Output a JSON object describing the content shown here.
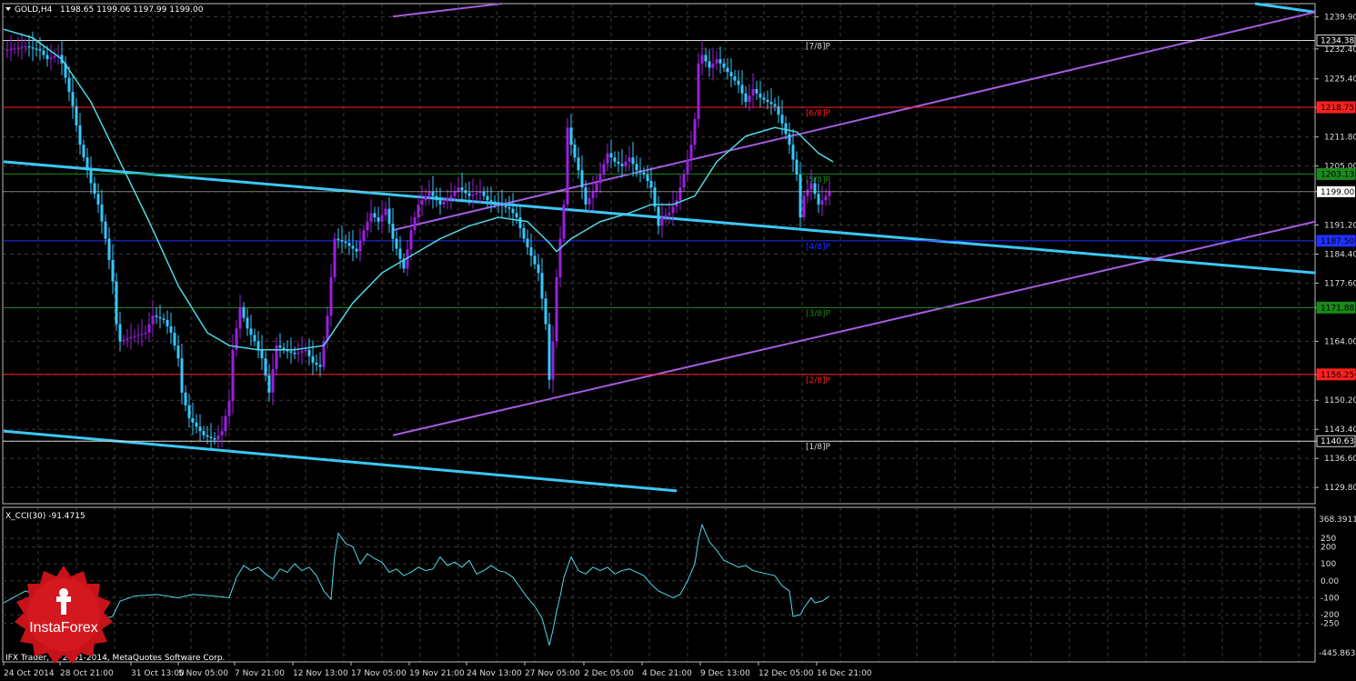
{
  "header": {
    "symbol": "GOLD,H4",
    "ohlc": "1198.65 1199.06 1197.99 1199.00"
  },
  "indicator": {
    "label": "X_CCI(30) -91.4715",
    "max_label": "368.3911",
    "min_label": "-445.8639",
    "levels": [
      "250",
      "200",
      "100",
      "0.00",
      "-100",
      "-200",
      "-250"
    ]
  },
  "footer": {
    "copyright": "IFX Trader, © 2001-2014, MetaQuotes Software Corp."
  },
  "logo": {
    "text": "InstaForex"
  },
  "colors": {
    "background": "#000000",
    "grid": "#3a3a3a",
    "bull": "#9b1fe0",
    "bear": "#35c8ff",
    "ma": "#4fd8e6",
    "channel_cyan": "#3cc7f5",
    "channel_violet": "#a65be0",
    "level_red": "#ff2020",
    "level_blue": "#2030ff",
    "level_green": "#1a8a1a",
    "level_white": "#d8d8d8"
  },
  "chart_data": {
    "type": "candlestick",
    "symbol": "GOLD",
    "timeframe": "H4",
    "price_axis": {
      "ylim": [
        1126.0,
        1243.0
      ],
      "ticks": [
        "1239.90",
        "1232.40",
        "1225.40",
        "1218.75",
        "1211.80",
        "1205.00",
        "1199.00",
        "1191.20",
        "1184.40",
        "1177.60",
        "1171.88",
        "1164.00",
        "1156.20",
        "1150.20",
        "1143.40",
        "1140.63",
        "1136.60",
        "1129.80"
      ]
    },
    "time_labels": [
      "24 Oct 2014",
      "28 Oct 21:00",
      "31 Oct 13:00",
      "5 Nov 05:00",
      "7 Nov 21:00",
      "12 Nov 13:00",
      "17 Nov 05:00",
      "19 Nov 21:00",
      "24 Nov 13:00",
      "27 Nov 05:00",
      "2 Dec 05:00",
      "4 Dec 21:00",
      "9 Dec 13:00",
      "12 Dec 05:00",
      "16 Dec 21:00"
    ],
    "current_price": "1199.00",
    "murrey_levels": [
      {
        "price": 1234.38,
        "label": "[7/8]P",
        "price_label": "1234.38",
        "color": "#d8d8d8"
      },
      {
        "price": 1218.75,
        "label": "[6/8]P",
        "price_label": "1218.75",
        "color": "#ff2020"
      },
      {
        "price": 1203.13,
        "label": "[5/8]P",
        "price_label": "1203.13",
        "color": "#1a8a1a"
      },
      {
        "price": 1187.5,
        "label": "[4/8]P",
        "price_label": "1187.50",
        "color": "#2030ff"
      },
      {
        "price": 1171.88,
        "label": "[3/8]P",
        "price_label": "1171.88",
        "color": "#1a8a1a"
      },
      {
        "price": 1156.25,
        "label": "[2/8]P",
        "price_label": "1156.25",
        "color": "#ff2020"
      },
      {
        "price": 1140.63,
        "label": "[1/8]P",
        "price_label": "1140.63",
        "color": "#d8d8d8"
      }
    ],
    "price_path": [
      [
        0,
        1232
      ],
      [
        6,
        1233
      ],
      [
        10,
        1232
      ],
      [
        12,
        1230
      ],
      [
        15,
        1231
      ],
      [
        16,
        1229
      ],
      [
        19,
        1219
      ],
      [
        21,
        1210
      ],
      [
        24,
        1201
      ],
      [
        26,
        1196
      ],
      [
        28,
        1188
      ],
      [
        30,
        1178
      ],
      [
        31,
        1168
      ],
      [
        32,
        1164
      ],
      [
        35,
        1165
      ],
      [
        39,
        1166
      ],
      [
        41,
        1170
      ],
      [
        44,
        1169
      ],
      [
        46,
        1166
      ],
      [
        48,
        1160
      ],
      [
        49,
        1152
      ],
      [
        51,
        1146
      ],
      [
        53,
        1144
      ],
      [
        55,
        1142
      ],
      [
        58,
        1141
      ],
      [
        60,
        1143
      ],
      [
        62,
        1150
      ],
      [
        63,
        1162
      ],
      [
        65,
        1172
      ],
      [
        67,
        1167
      ],
      [
        69,
        1164
      ],
      [
        71,
        1160
      ],
      [
        73,
        1152
      ],
      [
        75,
        1163
      ],
      [
        77,
        1162
      ],
      [
        80,
        1161
      ],
      [
        83,
        1162
      ],
      [
        85,
        1159
      ],
      [
        87,
        1158
      ],
      [
        89,
        1170
      ],
      [
        91,
        1188
      ],
      [
        94,
        1187
      ],
      [
        97,
        1185
      ],
      [
        99,
        1190
      ],
      [
        101,
        1194
      ],
      [
        103,
        1192
      ],
      [
        105,
        1195
      ],
      [
        107,
        1188
      ],
      [
        110,
        1181
      ],
      [
        112,
        1190
      ],
      [
        114,
        1196
      ],
      [
        117,
        1199
      ],
      [
        120,
        1196
      ],
      [
        123,
        1198
      ],
      [
        125,
        1200
      ],
      [
        128,
        1198
      ],
      [
        131,
        1199
      ],
      [
        133,
        1197
      ],
      [
        136,
        1196
      ],
      [
        139,
        1195
      ],
      [
        141,
        1193
      ],
      [
        143,
        1188
      ],
      [
        145,
        1184
      ],
      [
        147,
        1180
      ],
      [
        149,
        1168
      ],
      [
        150,
        1155
      ],
      [
        151,
        1164
      ],
      [
        152,
        1179
      ],
      [
        153,
        1188
      ],
      [
        154,
        1196
      ],
      [
        155,
        1214
      ],
      [
        156,
        1210
      ],
      [
        158,
        1204
      ],
      [
        160,
        1196
      ],
      [
        162,
        1199
      ],
      [
        164,
        1203
      ],
      [
        166,
        1208
      ],
      [
        168,
        1206
      ],
      [
        170,
        1205
      ],
      [
        172,
        1207
      ],
      [
        174,
        1204
      ],
      [
        176,
        1203
      ],
      [
        178,
        1200
      ],
      [
        180,
        1191
      ],
      [
        181,
        1193
      ],
      [
        183,
        1194
      ],
      [
        185,
        1197
      ],
      [
        187,
        1203
      ],
      [
        189,
        1210
      ],
      [
        190,
        1216
      ],
      [
        191,
        1229
      ],
      [
        192,
        1231
      ],
      [
        194,
        1228
      ],
      [
        196,
        1230
      ],
      [
        198,
        1228
      ],
      [
        200,
        1226
      ],
      [
        202,
        1224
      ],
      [
        204,
        1220
      ],
      [
        206,
        1223
      ],
      [
        208,
        1221
      ],
      [
        210,
        1220
      ],
      [
        212,
        1219
      ],
      [
        214,
        1215
      ],
      [
        216,
        1210
      ],
      [
        218,
        1203
      ],
      [
        219,
        1193
      ],
      [
        220,
        1198
      ],
      [
        222,
        1201
      ],
      [
        224,
        1196
      ],
      [
        225,
        1197
      ],
      [
        227,
        1199
      ]
    ],
    "moving_average": [
      [
        0,
        1237
      ],
      [
        8,
        1235
      ],
      [
        16,
        1230
      ],
      [
        24,
        1220
      ],
      [
        32,
        1206
      ],
      [
        40,
        1192
      ],
      [
        48,
        1177
      ],
      [
        56,
        1166
      ],
      [
        62,
        1163
      ],
      [
        70,
        1162
      ],
      [
        80,
        1162
      ],
      [
        88,
        1163
      ],
      [
        96,
        1173
      ],
      [
        104,
        1180
      ],
      [
        112,
        1184
      ],
      [
        120,
        1188
      ],
      [
        128,
        1191
      ],
      [
        136,
        1193
      ],
      [
        144,
        1192
      ],
      [
        150,
        1187
      ],
      [
        152,
        1185
      ],
      [
        156,
        1188
      ],
      [
        164,
        1192
      ],
      [
        172,
        1194
      ],
      [
        178,
        1196
      ],
      [
        184,
        1196
      ],
      [
        190,
        1198
      ],
      [
        196,
        1206
      ],
      [
        204,
        1212
      ],
      [
        212,
        1214
      ],
      [
        218,
        1213
      ],
      [
        224,
        1208
      ],
      [
        228,
        1206
      ]
    ],
    "trend_lines": [
      {
        "color": "cyan",
        "points": [
          [
            0,
            1206
          ],
          [
            370,
            1180
          ]
        ]
      },
      {
        "color": "cyan",
        "points": [
          [
            0,
            1143
          ],
          [
            185,
            1129
          ]
        ]
      },
      {
        "color": "cyan",
        "points": [
          [
            344,
            1243
          ],
          [
            370,
            1241
          ]
        ]
      },
      {
        "color": "violet",
        "points": [
          [
            107,
            1190
          ],
          [
            370,
            1241
          ]
        ]
      },
      {
        "color": "violet",
        "points": [
          [
            107,
            1142
          ],
          [
            370,
            1192
          ]
        ]
      },
      {
        "color": "violet",
        "points": [
          [
            107,
            1240
          ],
          [
            137,
            1243
          ]
        ]
      }
    ],
    "cci": {
      "ylim": [
        -445.8639,
        368.3911
      ],
      "levels": [
        250,
        200,
        100,
        0,
        -100,
        -200,
        -250
      ],
      "path": [
        [
          0,
          -130
        ],
        [
          6,
          -60
        ],
        [
          10,
          -90
        ],
        [
          14,
          -70
        ],
        [
          18,
          -110
        ],
        [
          22,
          -180
        ],
        [
          26,
          -230
        ],
        [
          30,
          -210
        ],
        [
          32,
          -120
        ],
        [
          36,
          -90
        ],
        [
          42,
          -80
        ],
        [
          48,
          -100
        ],
        [
          52,
          -80
        ],
        [
          58,
          -90
        ],
        [
          62,
          -100
        ],
        [
          64,
          20
        ],
        [
          66,
          90
        ],
        [
          68,
          60
        ],
        [
          70,
          80
        ],
        [
          72,
          40
        ],
        [
          74,
          10
        ],
        [
          76,
          70
        ],
        [
          78,
          50
        ],
        [
          80,
          100
        ],
        [
          82,
          60
        ],
        [
          84,
          80
        ],
        [
          86,
          30
        ],
        [
          88,
          -60
        ],
        [
          90,
          -110
        ],
        [
          91,
          150
        ],
        [
          92,
          280
        ],
        [
          94,
          220
        ],
        [
          96,
          200
        ],
        [
          98,
          100
        ],
        [
          100,
          160
        ],
        [
          102,
          130
        ],
        [
          104,
          110
        ],
        [
          106,
          50
        ],
        [
          108,
          70
        ],
        [
          110,
          30
        ],
        [
          112,
          50
        ],
        [
          114,
          80
        ],
        [
          116,
          60
        ],
        [
          118,
          70
        ],
        [
          120,
          140
        ],
        [
          122,
          90
        ],
        [
          124,
          110
        ],
        [
          126,
          80
        ],
        [
          128,
          120
        ],
        [
          130,
          40
        ],
        [
          132,
          60
        ],
        [
          134,
          90
        ],
        [
          136,
          60
        ],
        [
          138,
          50
        ],
        [
          140,
          20
        ],
        [
          142,
          -40
        ],
        [
          144,
          -100
        ],
        [
          146,
          -150
        ],
        [
          148,
          -220
        ],
        [
          150,
          -380
        ],
        [
          151,
          -290
        ],
        [
          152,
          -180
        ],
        [
          153,
          -90
        ],
        [
          154,
          20
        ],
        [
          156,
          140
        ],
        [
          158,
          60
        ],
        [
          160,
          40
        ],
        [
          162,
          80
        ],
        [
          164,
          60
        ],
        [
          166,
          80
        ],
        [
          168,
          40
        ],
        [
          170,
          60
        ],
        [
          172,
          70
        ],
        [
          174,
          50
        ],
        [
          176,
          30
        ],
        [
          178,
          -20
        ],
        [
          180,
          -60
        ],
        [
          182,
          -80
        ],
        [
          184,
          -100
        ],
        [
          186,
          -80
        ],
        [
          188,
          0
        ],
        [
          190,
          100
        ],
        [
          191,
          240
        ],
        [
          192,
          330
        ],
        [
          194,
          230
        ],
        [
          196,
          180
        ],
        [
          198,
          120
        ],
        [
          200,
          100
        ],
        [
          202,
          80
        ],
        [
          204,
          90
        ],
        [
          206,
          60
        ],
        [
          208,
          50
        ],
        [
          210,
          40
        ],
        [
          212,
          30
        ],
        [
          214,
          -30
        ],
        [
          216,
          -60
        ],
        [
          217,
          -210
        ],
        [
          219,
          -200
        ],
        [
          220,
          -160
        ],
        [
          222,
          -100
        ],
        [
          223,
          -130
        ],
        [
          225,
          -120
        ],
        [
          227,
          -91
        ]
      ]
    }
  }
}
